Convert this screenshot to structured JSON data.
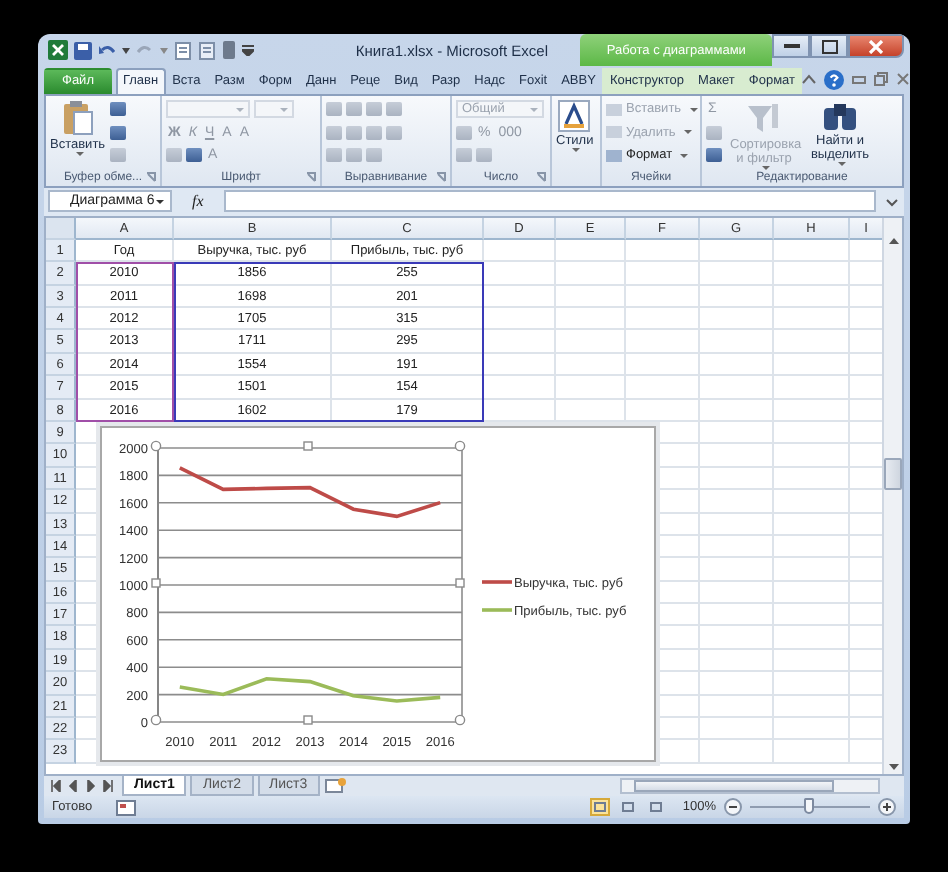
{
  "window": {
    "title": "Книга1.xlsx - Microsoft Excel",
    "context_title": "Работа с диаграммами"
  },
  "ribbon_tabs": [
    {
      "label": "Файл",
      "kind": "file",
      "selected": false
    },
    {
      "label": "Главн",
      "kind": "tab",
      "selected": true
    },
    {
      "label": "Вста",
      "kind": "tab",
      "selected": false
    },
    {
      "label": "Разм",
      "kind": "tab",
      "selected": false
    },
    {
      "label": "Форм",
      "kind": "tab",
      "selected": false
    },
    {
      "label": "Данн",
      "kind": "tab",
      "selected": false
    },
    {
      "label": "Реце",
      "kind": "tab",
      "selected": false
    },
    {
      "label": "Вид",
      "kind": "tab",
      "selected": false
    },
    {
      "label": "Разр",
      "kind": "tab",
      "selected": false
    },
    {
      "label": "Надс",
      "kind": "tab",
      "selected": false
    },
    {
      "label": "Foxit",
      "kind": "tab",
      "selected": false
    },
    {
      "label": "ABBY",
      "kind": "tab",
      "selected": false
    },
    {
      "label": "Конструктор",
      "kind": "context",
      "selected": false
    },
    {
      "label": "Макет",
      "kind": "context",
      "selected": false
    },
    {
      "label": "Формат",
      "kind": "context",
      "selected": false
    }
  ],
  "ribbon_groups": [
    {
      "label": "Буфер обме...",
      "launcher": true,
      "lead": [
        {
          "kind": "paste",
          "label": "Вставить",
          "disabled": false
        }
      ],
      "rows": [
        [
          {
            "kind": "icon",
            "disabled": false
          }
        ],
        [
          {
            "kind": "icon",
            "disabled": false
          }
        ],
        [
          {
            "kind": "icon",
            "disabled": true
          }
        ]
      ]
    },
    {
      "label": "Шрифт",
      "launcher": true,
      "rows": [
        [
          {
            "kind": "combo",
            "wide": true,
            "disabled": true
          },
          {
            "kind": "combo",
            "wide": false,
            "disabled": true
          }
        ],
        [
          {
            "kind": "bold",
            "label": "Ж",
            "disabled": true
          },
          {
            "kind": "italic",
            "label": "К",
            "disabled": true
          },
          {
            "kind": "underline",
            "label": "Ч",
            "disabled": true
          },
          {
            "kind": "text",
            "label": "A",
            "disabled": true
          },
          {
            "kind": "text",
            "label": "A",
            "disabled": true
          }
        ],
        [
          {
            "kind": "icon",
            "disabled": true
          },
          {
            "kind": "icon",
            "disabled": false
          },
          {
            "kind": "text",
            "label": "A",
            "disabled": true
          }
        ]
      ]
    },
    {
      "label": "Выравнивание",
      "launcher": true,
      "rows": [
        [
          {
            "kind": "icon",
            "disabled": true
          },
          {
            "kind": "icon",
            "disabled": true
          },
          {
            "kind": "icon",
            "disabled": true
          },
          {
            "kind": "icon",
            "disabled": true
          }
        ],
        [
          {
            "kind": "icon",
            "disabled": true
          },
          {
            "kind": "icon",
            "disabled": true
          },
          {
            "kind": "icon",
            "disabled": true
          },
          {
            "kind": "icon",
            "disabled": true
          }
        ],
        [
          {
            "kind": "icon",
            "disabled": true
          },
          {
            "kind": "icon",
            "disabled": true
          },
          {
            "kind": "icon",
            "disabled": true
          }
        ]
      ]
    },
    {
      "label": "Число",
      "launcher": true,
      "rows": [
        [
          {
            "kind": "combo",
            "wide": true,
            "value": "Общий",
            "disabled": true
          }
        ],
        [
          {
            "kind": "icon",
            "disabled": true
          },
          {
            "kind": "text",
            "label": "%",
            "disabled": true
          },
          {
            "kind": "text",
            "label": "000",
            "disabled": true
          }
        ],
        [
          {
            "kind": "icon",
            "disabled": true
          },
          {
            "kind": "icon",
            "disabled": true
          }
        ]
      ]
    },
    {
      "launcher": false,
      "lead": [
        {
          "kind": "styles",
          "label": "Стили",
          "disabled": false
        }
      ]
    },
    {
      "label": "Ячейки",
      "launcher": false,
      "rows": [
        [
          {
            "kind": "menu",
            "label": "Вставить",
            "disabled": true
          }
        ],
        [
          {
            "kind": "menu",
            "label": "Удалить",
            "disabled": true
          }
        ],
        [
          {
            "kind": "menu",
            "label": "Формат",
            "disabled": false
          }
        ]
      ]
    },
    {
      "label": "Редактирование",
      "launcher": false,
      "rows": [
        [
          {
            "kind": "text",
            "label": "Σ",
            "disabled": true
          }
        ],
        [
          {
            "kind": "icon",
            "disabled": true
          }
        ],
        [
          {
            "kind": "icon",
            "disabled": false
          }
        ]
      ],
      "trail": [
        {
          "kind": "sort",
          "label": "Сортировка и фильтр",
          "disabled": true
        },
        {
          "kind": "find",
          "label": "Найти и выделить",
          "disabled": false
        }
      ]
    }
  ],
  "formula_bar": {
    "name_box": "Диаграмма 6",
    "function_label": "fx"
  },
  "sheet": {
    "columns": [
      "A",
      "B",
      "C",
      "D",
      "E",
      "F",
      "G",
      "H",
      "I"
    ],
    "rows": [
      {
        "number": "1",
        "cells": [
          "Год",
          "Выручка, тыс. руб",
          "Прибыль, тыс. руб"
        ]
      },
      {
        "number": "2",
        "cells": [
          "2010",
          "1856",
          "255"
        ]
      },
      {
        "number": "3",
        "cells": [
          "2011",
          "1698",
          "201"
        ]
      },
      {
        "number": "4",
        "cells": [
          "2012",
          "1705",
          "315"
        ]
      },
      {
        "number": "5",
        "cells": [
          "2013",
          "1711",
          "295"
        ]
      },
      {
        "number": "6",
        "cells": [
          "2014",
          "1554",
          "191"
        ]
      },
      {
        "number": "7",
        "cells": [
          "2015",
          "1501",
          "154"
        ]
      },
      {
        "number": "8",
        "cells": [
          "2016",
          "1602",
          "179"
        ]
      },
      {
        "number": "9"
      },
      {
        "number": "10"
      },
      {
        "number": "11"
      },
      {
        "number": "12"
      },
      {
        "number": "13"
      },
      {
        "number": "14"
      },
      {
        "number": "15"
      },
      {
        "number": "16"
      },
      {
        "number": "17"
      },
      {
        "number": "18"
      },
      {
        "number": "19"
      },
      {
        "number": "20"
      },
      {
        "number": "21"
      },
      {
        "number": "22"
      },
      {
        "number": "23"
      }
    ],
    "chart": {
      "chart_data": {
        "type": "line",
        "categories": [
          "2010",
          "2011",
          "2012",
          "2013",
          "2014",
          "2015",
          "2016"
        ],
        "series": [
          {
            "name": "Выручка, тыс. руб",
            "color": "#be4b48",
            "values": [
              1856,
              1698,
              1705,
              1711,
              1554,
              1501,
              1602
            ]
          },
          {
            "name": "Прибыль, тыс. руб",
            "color": "#9bbb59",
            "values": [
              255,
              201,
              315,
              295,
              191,
              154,
              179
            ]
          }
        ],
        "ylim": [
          0,
          2000
        ],
        "yticks": [
          0,
          200,
          400,
          600,
          800,
          1000,
          1200,
          1400,
          1600,
          1800,
          2000
        ],
        "grid": true,
        "legend": "right"
      }
    }
  },
  "sheet_tabs": [
    {
      "label": "Лист1",
      "selected": true
    },
    {
      "label": "Лист2",
      "selected": false
    },
    {
      "label": "Лист3",
      "selected": false
    }
  ],
  "status_bar": {
    "status": "Готово",
    "views": [
      {
        "selected": true
      },
      {
        "selected": false
      },
      {
        "selected": false
      }
    ],
    "zoom": "100%",
    "zoom_level": {
      "level": 0.49
    }
  }
}
